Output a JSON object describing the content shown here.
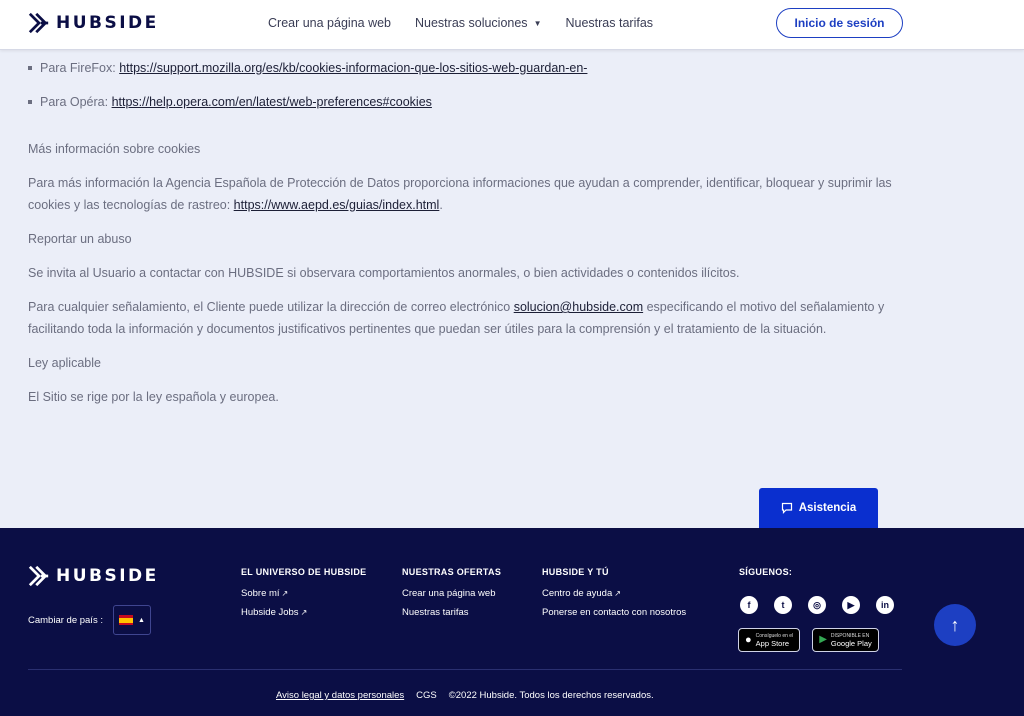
{
  "header": {
    "brand": "HUBSIDE",
    "nav": [
      {
        "label": "Crear una página web"
      },
      {
        "label": "Nuestras soluciones",
        "has_dropdown": true
      },
      {
        "label": "Nuestras tarifas"
      }
    ],
    "login_label": "Inicio de sesión"
  },
  "content": {
    "bullets": [
      {
        "label": "Para FireFox: ",
        "link": "https://support.mozilla.org/es/kb/cookies-informacion-que-los-sitios-web-guardan-en-"
      },
      {
        "label": "Para Opéra: ",
        "link": "https://help.opera.com/en/latest/web-preferences#cookies"
      }
    ],
    "more_info_heading": "Más información sobre cookies",
    "more_info_text": "Para más información la Agencia Española de Protección de Datos proporciona informaciones que ayudan a comprender, identificar, bloquear y suprimir las cookies y las tecnologías de rastreo: ",
    "more_info_link": "https://www.aepd.es/guias/index.html",
    "more_info_end": ".",
    "abuse_heading": "Reportar un abuso",
    "abuse_text": "Se invita al Usuario a contactar con HUBSIDE si observara comportamientos anormales, o bien actividades o contenidos ilícitos.",
    "report_text_1": "Para cualquier señalamiento, el Cliente puede utilizar la dirección de correo electrónico ",
    "report_email": "solucion@hubside.com",
    "report_text_2": " especificando el motivo del señalamiento y facilitando toda la información y documentos justificativos pertinentes que puedan ser útiles para la comprensión y el tratamiento de la situación.",
    "law_heading": "Ley aplicable",
    "law_text": "El Sitio se rige por la ley española y europea."
  },
  "assist_label": "Asistencia",
  "footer": {
    "brand": "HUBSIDE",
    "country_label": "Cambiar de país :",
    "columns": [
      {
        "title": "EL UNIVERSO DE HUBSIDE",
        "links": [
          "Sobre mí",
          "Hubside Jobs"
        ]
      },
      {
        "title": "NUESTRAS OFERTAS",
        "links": [
          "Crear una página web",
          "Nuestras tarifas"
        ]
      },
      {
        "title": "HUBSIDE Y TÚ",
        "links": [
          "Centro de ayuda",
          "Ponerse en contacto con nosotros"
        ]
      }
    ],
    "social_title": "SÍGUENOS:",
    "social_icons": [
      "facebook-icon",
      "twitter-icon",
      "instagram-icon",
      "youtube-icon",
      "linkedin-icon"
    ],
    "app_store": {
      "small": "Consíguelo en el",
      "name": "App Store"
    },
    "google_play": {
      "small": "DISPONIBLE EN",
      "name": "Google Play"
    },
    "legal_link": "Aviso legal y datos personales",
    "cgs": "CGS",
    "copyright": "©2022 Hubside. Todos los derechos reservados."
  }
}
